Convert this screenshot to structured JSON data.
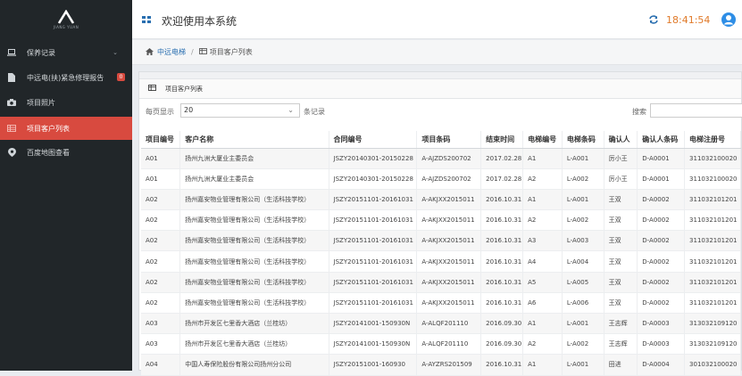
{
  "sidebar": {
    "logo_text": "JIANG YUAN",
    "items": [
      {
        "label": "保养记录",
        "icon": "laptop-icon"
      },
      {
        "label": "中远电(扶)紧急修理报告",
        "icon": "file-icon",
        "badge": "0"
      },
      {
        "label": "项目照片",
        "icon": "camera-icon"
      },
      {
        "label": "项目客户列表",
        "icon": "table-icon"
      },
      {
        "label": "百度地图查看",
        "icon": "map-marker-icon"
      }
    ]
  },
  "header": {
    "title": "欢迎使用本系统",
    "time": "18:41:54"
  },
  "breadcrumb": {
    "home": "中远电梯",
    "current": "项目客户列表"
  },
  "panel": {
    "title": "项目客户列表",
    "page_size_label": "每页显示",
    "page_size_value": "20",
    "records_label": "条记录",
    "search_label": "搜索"
  },
  "table": {
    "columns": [
      "项目编号",
      "客户名称",
      "合同编号",
      "项目条码",
      "结束时间",
      "电梯编号",
      "电梯条码",
      "确认人",
      "确认人条码",
      "电梯注册号"
    ],
    "rows": [
      [
        "A01",
        "扬州九洲大厦业主委员会",
        "JSZY20140301-20150228",
        "A-AJZDS200702",
        "2017.02.28",
        "A1",
        "L-A001",
        "厉小王",
        "D-A0001",
        "311032100020"
      ],
      [
        "A01",
        "扬州九洲大厦业主委员会",
        "JSZY20140301-20150228",
        "A-AJZDS200702",
        "2017.02.28",
        "A2",
        "L-A002",
        "厉小王",
        "D-A0001",
        "311032100020"
      ],
      [
        "A02",
        "扬州嘉安物业管理有限公司（生活科技学校）",
        "JSZY20151101-20161031",
        "A-AKJXX2015011",
        "2016.10.31",
        "A1",
        "L-A001",
        "王双",
        "D-A0002",
        "311032101201"
      ],
      [
        "A02",
        "扬州嘉安物业管理有限公司（生活科技学校）",
        "JSZY20151101-20161031",
        "A-AKJXX2015011",
        "2016.10.31",
        "A2",
        "L-A002",
        "王双",
        "D-A0002",
        "311032101201"
      ],
      [
        "A02",
        "扬州嘉安物业管理有限公司（生活科技学校）",
        "JSZY20151101-20161031",
        "A-AKJXX2015011",
        "2016.10.31",
        "A3",
        "L-A003",
        "王双",
        "D-A0002",
        "311032101201"
      ],
      [
        "A02",
        "扬州嘉安物业管理有限公司（生活科技学校）",
        "JSZY20151101-20161031",
        "A-AKJXX2015011",
        "2016.10.31",
        "A4",
        "L-A004",
        "王双",
        "D-A0002",
        "311032101201"
      ],
      [
        "A02",
        "扬州嘉安物业管理有限公司（生活科技学校）",
        "JSZY20151101-20161031",
        "A-AKJXX2015011",
        "2016.10.31",
        "A5",
        "L-A005",
        "王双",
        "D-A0002",
        "311032101201"
      ],
      [
        "A02",
        "扬州嘉安物业管理有限公司（生活科技学校）",
        "JSZY20151101-20161031",
        "A-AKJXX2015011",
        "2016.10.31",
        "A6",
        "L-A006",
        "王双",
        "D-A0002",
        "311032101201"
      ],
      [
        "A03",
        "扬州市开发区七里香大酒店（兰桂坊）",
        "JSZY20141001-150930N",
        "A-ALQF201110",
        "2016.09.30",
        "A1",
        "L-A001",
        "王志辉",
        "D-A0003",
        "313032109120"
      ],
      [
        "A03",
        "扬州市开发区七里香大酒店（兰桂坊）",
        "JSZY20141001-150930N",
        "A-ALQF201110",
        "2016.09.30",
        "A2",
        "L-A002",
        "王志辉",
        "D-A0003",
        "313032109120"
      ],
      [
        "A04",
        "中国人寿保险股份有限公司扬州分公司",
        "JSZY20151001-160930",
        "A-AYZRS201509",
        "2016.10.31",
        "A1",
        "L-A001",
        "田进",
        "D-A0004",
        "301032100020"
      ]
    ]
  },
  "colors": {
    "sidebar_bg": "#212629",
    "active_item": "#d84a3f",
    "clock": "#e07a2a",
    "link": "#2a6fb0"
  }
}
